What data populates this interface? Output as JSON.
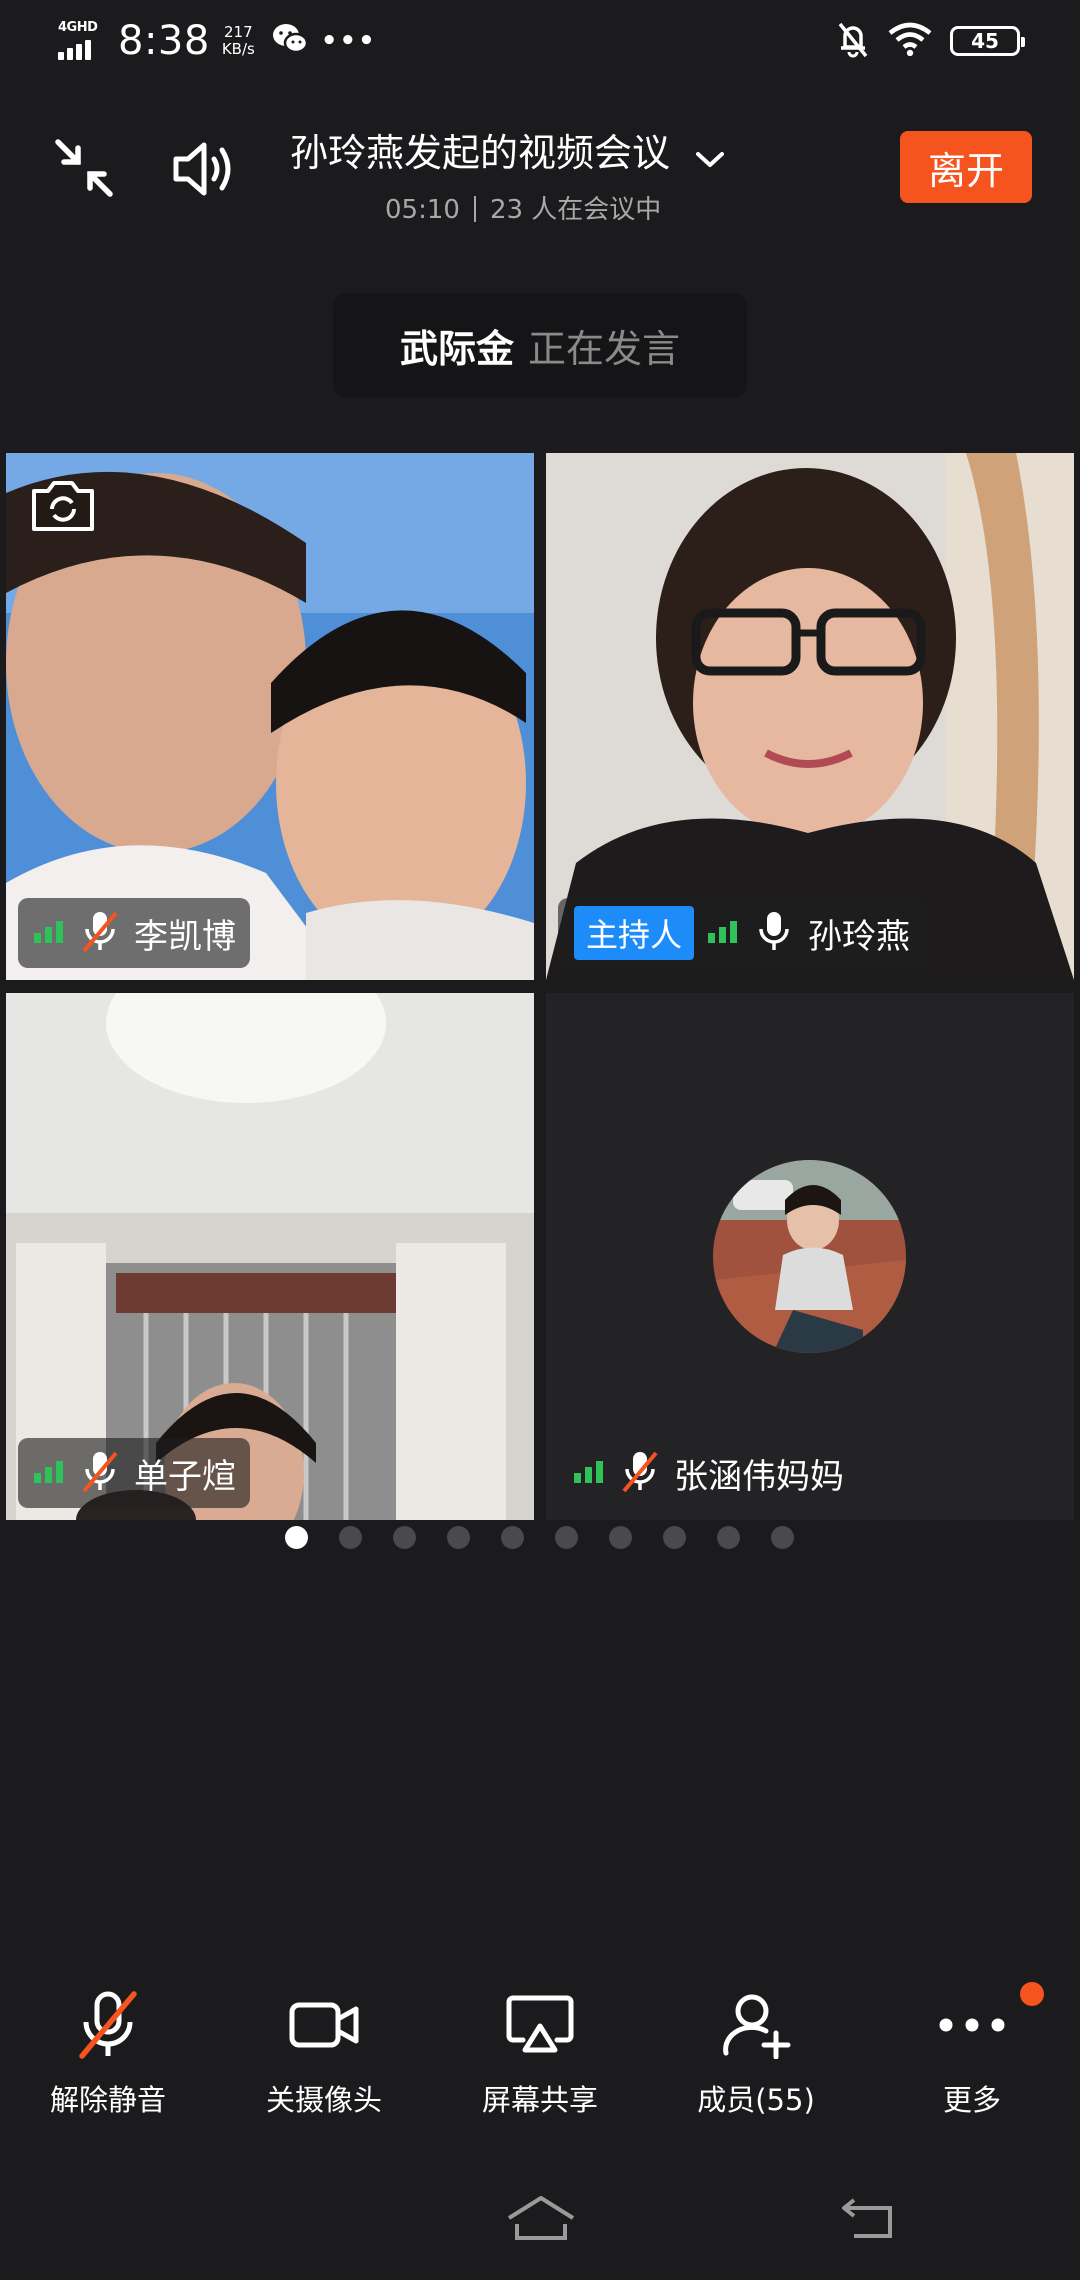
{
  "status_bar": {
    "network_type": "4GHD",
    "time": "8:38",
    "speed_value": "217",
    "speed_unit": "KB/s",
    "overflow": "•••",
    "battery": "45",
    "icons": [
      "wechat-icon",
      "mute-bell-icon",
      "wifi-icon",
      "battery-icon"
    ]
  },
  "header": {
    "title": "孙玲燕发起的视频会议",
    "duration": "05:10",
    "participants_text": "23 人在会议中",
    "leave_label": "离开"
  },
  "speaker": {
    "name": "武际金",
    "status": "正在发言"
  },
  "participants": [
    {
      "name": "李凯博",
      "host": false,
      "muted": true,
      "video": true
    },
    {
      "name": "孙玲燕",
      "host": true,
      "host_label": "主持人",
      "muted": false,
      "video": true
    },
    {
      "name": "单子煊",
      "host": false,
      "muted": true,
      "video": true
    },
    {
      "name": "张涵伟妈妈",
      "host": false,
      "muted": true,
      "video": false
    }
  ],
  "pager": {
    "pages": 10,
    "current": 1
  },
  "toolbar": {
    "unmute_label": "解除静音",
    "camera_label": "关摄像头",
    "share_label": "屏幕共享",
    "members_label": "成员(55)",
    "more_label": "更多"
  },
  "colors": {
    "background": "#1b1b1d",
    "leave": "#f5541f",
    "host_badge": "#1d8cf8",
    "signal": "#2fc25b",
    "mute_slash": "#f5541f"
  }
}
